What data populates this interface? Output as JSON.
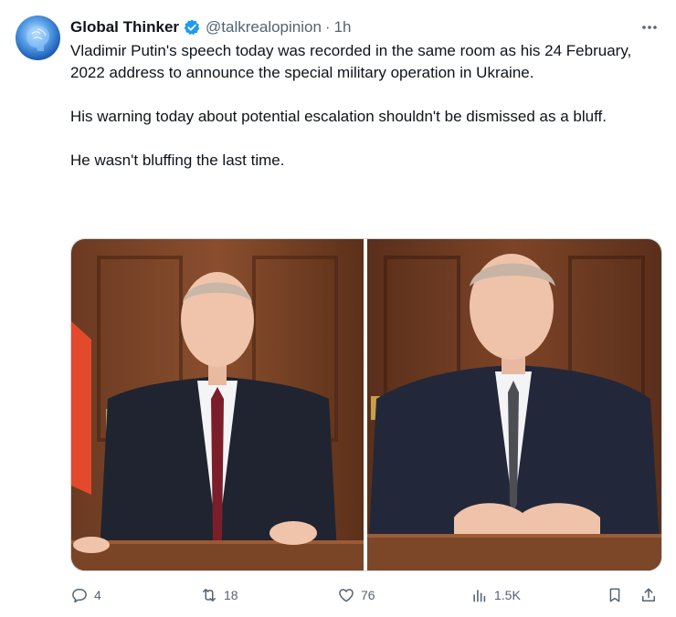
{
  "author": {
    "name": "Global Thinker",
    "handle": "@talkrealopinion",
    "separator": "·",
    "time": "1h",
    "avatar_icon": "brain-avatar",
    "verified_color": "#1d9bf0"
  },
  "tweet": {
    "paragraphs": [
      "Vladimir Putin's speech today was recorded in the same room as his 24 February, 2022 address to announce the special military operation in Ukraine.",
      "His warning today about potential escalation shouldn't be dismissed as a bluff.",
      "He wasn't bluffing the last time."
    ]
  },
  "media": {
    "images": [
      {
        "icon": "photo-man-at-desk-red-tie"
      },
      {
        "icon": "photo-man-at-desk-grey-tie"
      }
    ]
  },
  "actions": {
    "replies": "4",
    "reposts": "18",
    "likes": "76",
    "views": "1.5K"
  },
  "colors": {
    "text": "#0f1419",
    "secondary": "#536471",
    "border": "#cfd9de",
    "accent": "#1d9bf0"
  }
}
